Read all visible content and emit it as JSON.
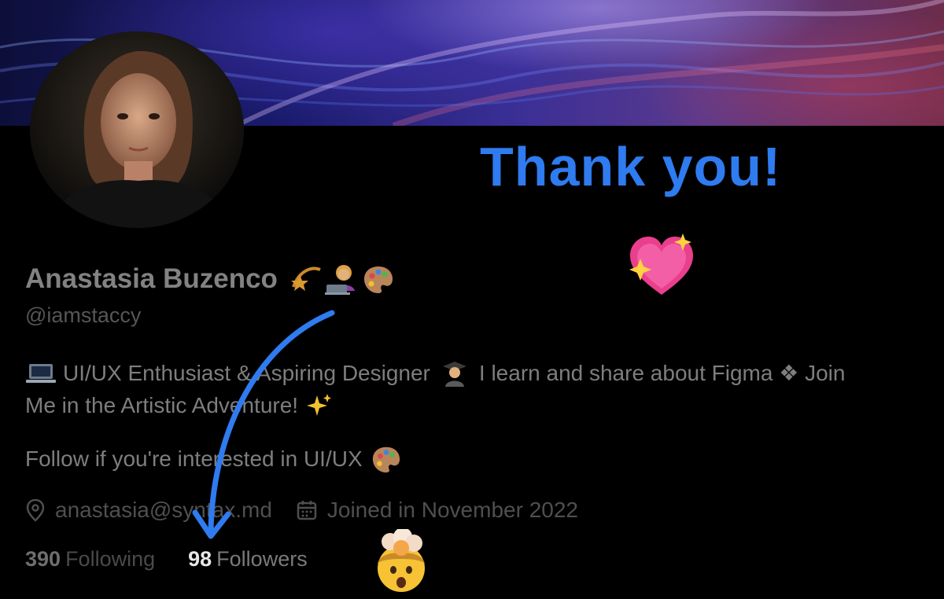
{
  "banner": {
    "description_icon": "abstract-wave-banner"
  },
  "avatar": {
    "icon": "profile-photo"
  },
  "annotation": {
    "text": "Thank you!",
    "color": "#2f7bf0",
    "heart_icon": "sparkling-heart-emoji",
    "reaction_icon": "mind-blown-emoji"
  },
  "profile": {
    "name": "Anastasia Buzenco",
    "name_emojis": [
      "dizzy-star-emoji",
      "woman-technologist-emoji",
      "artist-palette-emoji"
    ],
    "handle": "@iamstaccy",
    "bio_line1_pre": "UI/UX Enthusiast & Aspiring Designer",
    "bio_line1_mid": "I learn and share about Figma ❖ Join",
    "bio_line2": "Me in the Artistic Adventure!",
    "follow_text": "Follow if you're interested in UI/UX",
    "email": "anastasia@syntax.md",
    "joined": "Joined in November 2022",
    "following_count": "390",
    "following_label": "Following",
    "followers_count": "98",
    "followers_label": "Followers"
  }
}
